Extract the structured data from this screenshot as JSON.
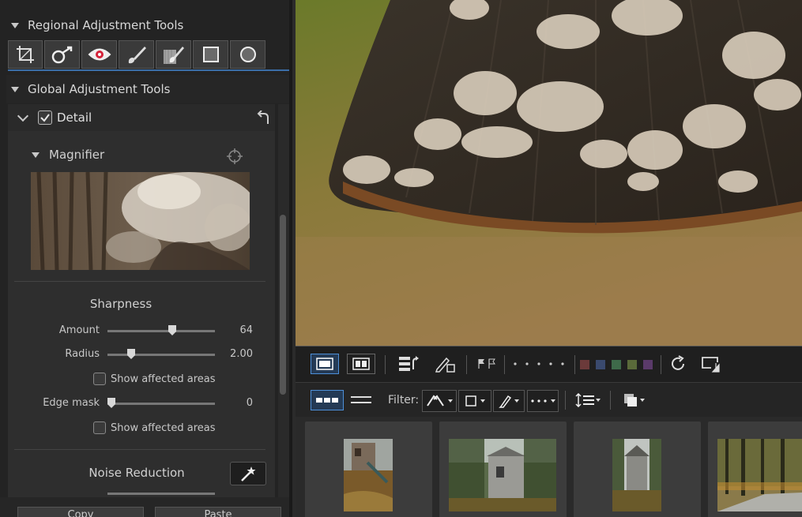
{
  "left_panel": {
    "regional_header": "Regional Adjustment Tools",
    "regional_tools": [
      "crop-tool",
      "spot-removal-tool",
      "red-eye-tool",
      "adjustment-brush-tool",
      "eraser-brush-tool",
      "rectangle-mask-tool",
      "circle-mask-tool"
    ],
    "global_header": "Global Adjustment Tools",
    "detail": {
      "label": "Detail",
      "checked": true,
      "magnifier_label": "Magnifier",
      "sharpness": {
        "title": "Sharpness",
        "amount_label": "Amount",
        "amount_value": "64",
        "amount_fraction": 0.61,
        "radius_label": "Radius",
        "radius_value": "2.00",
        "radius_fraction": 0.2,
        "show_affected_1": "Show affected areas",
        "edge_mask_label": "Edge mask",
        "edge_mask_value": "0",
        "edge_mask_fraction": 0.0,
        "show_affected_2": "Show affected areas"
      },
      "noise_reduction": {
        "title": "Noise Reduction"
      }
    },
    "copy_label": "Copy",
    "paste_label": "Paste"
  },
  "toolbar1": {
    "view_modes": [
      "single-view-icon",
      "compare-view-icon"
    ],
    "tools": [
      "sort-icon",
      "edit-pencil-icon",
      "flags-icon",
      "rating-dots-icon",
      "refresh-icon",
      "screen-icon"
    ],
    "color_labels": [
      "#6b3a3a",
      "#3a4a6e",
      "#3e6a4a",
      "#5a6a3a",
      "#5a3a6a"
    ]
  },
  "toolbar2": {
    "filter_label": "Filter:"
  },
  "thumbnails": [
    {
      "name": "thumbnail-1"
    },
    {
      "name": "thumbnail-2"
    },
    {
      "name": "thumbnail-3"
    },
    {
      "name": "thumbnail-4"
    }
  ]
}
